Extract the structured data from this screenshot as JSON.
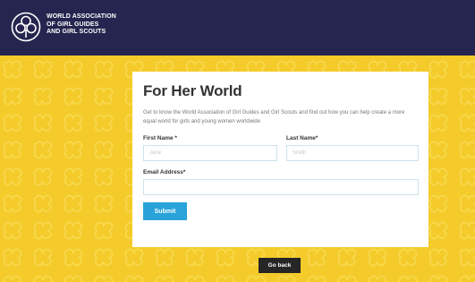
{
  "header": {
    "logo_lines": [
      "World Association",
      "of Girl Guides",
      "and Girl Scouts"
    ],
    "logo_icon": "trefoil-emblem-icon",
    "background_color": "#25254f"
  },
  "banner": {
    "background_color": "#f4cb2a",
    "pattern_icon": "trefoil-pattern"
  },
  "form": {
    "title": "For Her World",
    "description": "Get to know the World Association of Girl Guides and Girl Scouts and find out how you can help create a more equal world for girls and young women worldwide",
    "first_name": {
      "label": "First Name *",
      "placeholder": "Jane",
      "value": ""
    },
    "last_name": {
      "label": "Last Name*",
      "placeholder": "Smith",
      "value": ""
    },
    "email": {
      "label": "Email Address*",
      "placeholder": "",
      "value": ""
    },
    "submit_label": "Submit",
    "accent_color": "#29a3d9"
  },
  "go_back_label": "Go back"
}
